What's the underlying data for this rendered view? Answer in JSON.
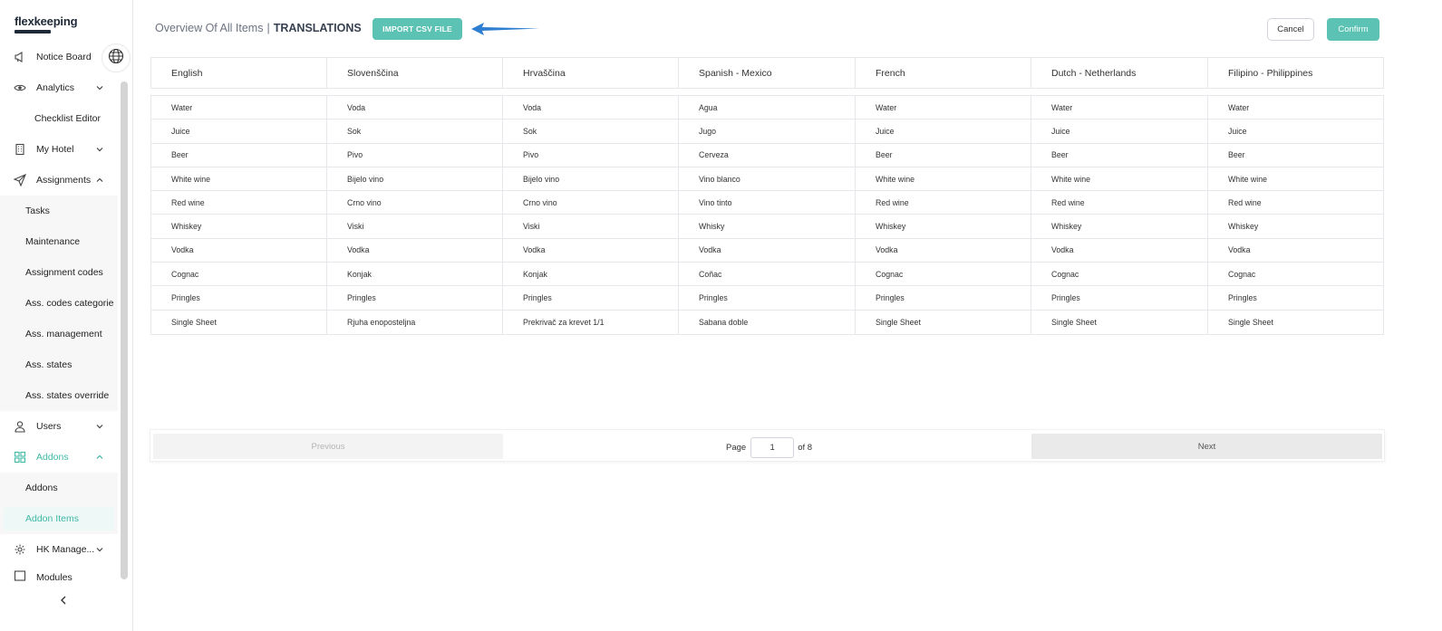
{
  "app": {
    "logo": "flexkeeping"
  },
  "sidebar": {
    "notice_board": "Notice Board",
    "analytics": "Analytics",
    "checklist_editor": "Checklist Editor",
    "my_hotel": "My Hotel",
    "assignments": "Assignments",
    "assignments_sub": [
      "Tasks",
      "Maintenance",
      "Assignment codes",
      "Ass. codes categorie",
      "Ass. management",
      "Ass. states",
      "Ass. states override"
    ],
    "users": "Users",
    "addons": "Addons",
    "addons_sub": [
      "Addons",
      "Addon Items"
    ],
    "hk_management": "HK Manage...",
    "modules": "Modules"
  },
  "header": {
    "breadcrumb_parent": "Overview Of All Items",
    "breadcrumb_sep": "|",
    "breadcrumb_current": "TRANSLATIONS",
    "import_label": "IMPORT CSV FILE",
    "cancel_label": "Cancel",
    "confirm_label": "Confirm"
  },
  "table": {
    "columns": [
      "English",
      "Slovenščina",
      "Hrvaščina",
      "Spanish - Mexico",
      "French",
      "Dutch - Netherlands",
      "Filipino - Philippines"
    ],
    "rows": [
      [
        "Water",
        "Voda",
        "Voda",
        "Agua",
        "Water",
        "Water",
        "Water"
      ],
      [
        "Juice",
        "Sok",
        "Sok",
        "Jugo",
        "Juice",
        "Juice",
        "Juice"
      ],
      [
        "Beer",
        "Pivo",
        "Pivo",
        "Cerveza",
        "Beer",
        "Beer",
        "Beer"
      ],
      [
        "White wine",
        "Bijelo vino",
        "Bijelo vino",
        "Vino blanco",
        "White wine",
        "White wine",
        "White wine"
      ],
      [
        "Red wine",
        "Crno vino",
        "Crno vino",
        "Vino tinto",
        "Red wine",
        "Red wine",
        "Red wine"
      ],
      [
        "Whiskey",
        "Viski",
        "Viski",
        "Whisky",
        "Whiskey",
        "Whiskey",
        "Whiskey"
      ],
      [
        "Vodka",
        "Vodka",
        "Vodka",
        "Vodka",
        "Vodka",
        "Vodka",
        "Vodka"
      ],
      [
        "Cognac",
        "Konjak",
        "Konjak",
        "Coñac",
        "Cognac",
        "Cognac",
        "Cognac"
      ],
      [
        "Pringles",
        "Pringles",
        "Pringles",
        "Pringles",
        "Pringles",
        "Pringles",
        "Pringles"
      ],
      [
        "Single Sheet",
        "Rjuha enoposteljna",
        "Prekrivač za krevet 1/1",
        "Sabana doble",
        "Single Sheet",
        "Single Sheet",
        "Single Sheet"
      ]
    ]
  },
  "pagination": {
    "previous_label": "Previous",
    "page_label": "Page",
    "current_page": "1",
    "of_label": "of 8",
    "next_label": "Next"
  },
  "colors": {
    "accent": "#5bc2b4",
    "arrow": "#2f7fd1"
  }
}
